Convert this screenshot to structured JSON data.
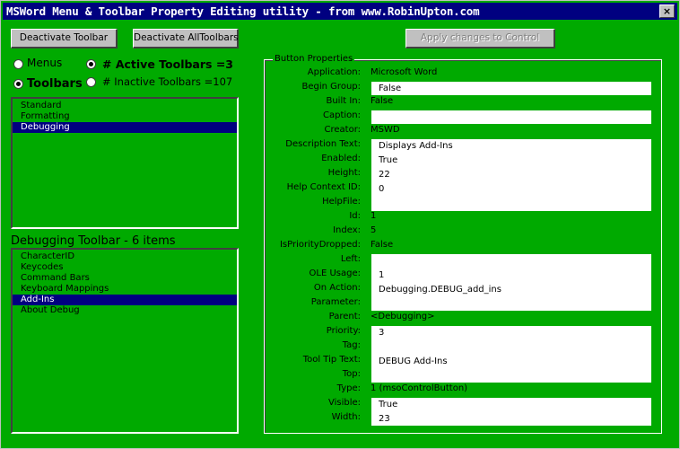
{
  "window": {
    "title": "MSWord Menu & Toolbar Property Editing utility - from www.RobinUpton.com",
    "close_label": "×"
  },
  "buttons": {
    "deactivate_toolbar": "Deactivate Toolbar",
    "deactivate_all": "Deactivate AllToolbars",
    "apply_changes": "Apply changes to Control"
  },
  "radios": {
    "menus": "Menus",
    "toolbars": "Toolbars",
    "active": "# Active Toolbars =3",
    "inactive": "# Inactive Toolbars =107"
  },
  "toolbars_list": [
    "Standard",
    "Formatting",
    "Debugging"
  ],
  "toolbar_caption": "Debugging Toolbar - 6 items",
  "items_list": [
    "CharacterID",
    "Keycodes",
    "Command Bars",
    "Keyboard Mappings",
    "Add-Ins",
    "About Debug"
  ],
  "props": {
    "frame_title": "Button Properties",
    "labels": {
      "application": "Application:",
      "begin_group": "Begin Group:",
      "built_in": "Built In:",
      "caption": "Caption:",
      "creator": "Creator:",
      "description_text": "Description Text:",
      "enabled": "Enabled:",
      "height": "Height:",
      "help_context_id": "Help Context ID:",
      "helpfile": "HelpFile:",
      "id": "Id:",
      "index": "Index:",
      "is_priority_dropped": "IsPriorityDropped:",
      "left": "Left:",
      "ole_usage": "OLE Usage:",
      "on_action": "On Action:",
      "parameter": "Parameter:",
      "parent": "Parent:",
      "priority": "Priority:",
      "tag": "Tag:",
      "tool_tip_text": "Tool Tip Text:",
      "top": "Top:",
      "type": "Type:",
      "visible": "Visible:",
      "width": "Width:"
    },
    "values": {
      "application": "Microsoft Word",
      "begin_group": "False",
      "built_in": "False",
      "caption": "",
      "creator": "MSWD",
      "description_text": "Displays Add-Ins",
      "enabled": "True",
      "height": "22",
      "help_context_id": "0",
      "helpfile": "",
      "id": "1",
      "index": "5",
      "is_priority_dropped": "False",
      "left": "",
      "ole_usage": "1",
      "on_action": "Debugging.DEBUG_add_ins",
      "parameter": "",
      "parent": "<Debugging>",
      "priority": "3",
      "tag": "",
      "tool_tip_text": "DEBUG Add-Ins",
      "top": "",
      "type": "1 (msoControlButton)",
      "visible": "True",
      "width": "23"
    }
  }
}
